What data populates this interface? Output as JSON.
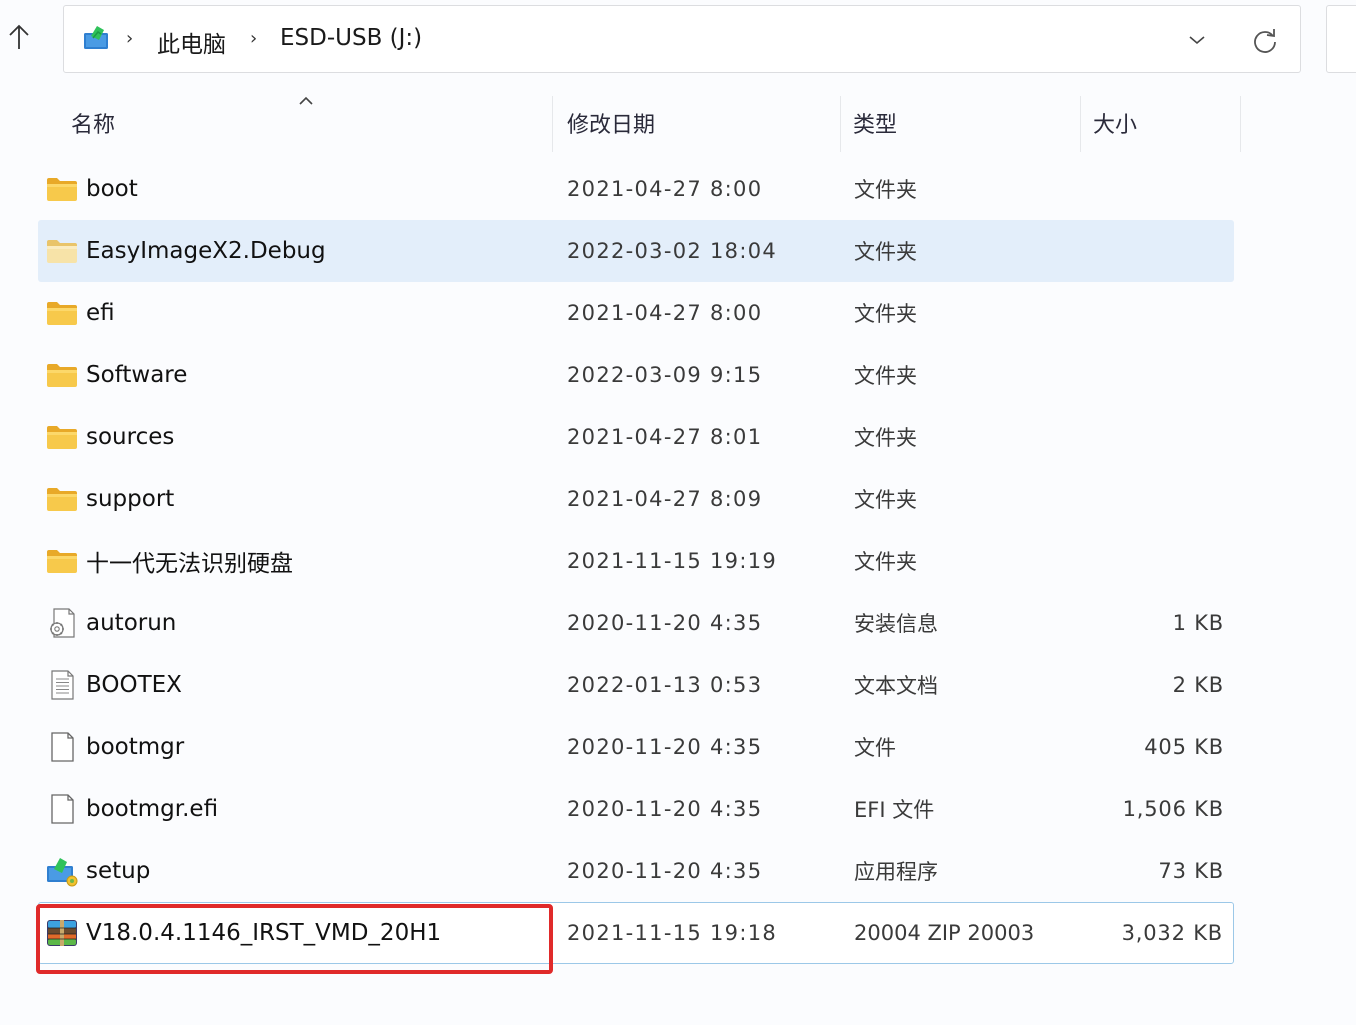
{
  "toolbar": {
    "up_icon": "arrow-up-icon",
    "breadcrumb": {
      "root_icon": "this-pc-icon",
      "separator": "›",
      "items": [
        "此电脑",
        "ESD-USB (J:)"
      ]
    },
    "dropdown_icon": "chevron-down-icon",
    "refresh_icon": "refresh-icon"
  },
  "columns": {
    "name": "名称",
    "date": "修改日期",
    "type": "类型",
    "size": "大小",
    "sort_indicator": "sort-ascending-icon"
  },
  "files": [
    {
      "name": "boot",
      "date": "2021-04-27 8:00",
      "type": "文件夹",
      "size": "",
      "icon": "folder-icon",
      "state": "normal"
    },
    {
      "name": "EasyImageX2.Debug",
      "date": "2022-03-02 18:04",
      "type": "文件夹",
      "size": "",
      "icon": "folder-icon",
      "state": "hover"
    },
    {
      "name": "efi",
      "date": "2021-04-27 8:00",
      "type": "文件夹",
      "size": "",
      "icon": "folder-icon",
      "state": "normal"
    },
    {
      "name": "Software",
      "date": "2022-03-09 9:15",
      "type": "文件夹",
      "size": "",
      "icon": "folder-icon",
      "state": "normal"
    },
    {
      "name": "sources",
      "date": "2021-04-27 8:01",
      "type": "文件夹",
      "size": "",
      "icon": "folder-icon",
      "state": "normal"
    },
    {
      "name": "support",
      "date": "2021-04-27 8:09",
      "type": "文件夹",
      "size": "",
      "icon": "folder-icon",
      "state": "normal"
    },
    {
      "name": "十一代无法识别硬盘",
      "date": "2021-11-15 19:19",
      "type": "文件夹",
      "size": "",
      "icon": "folder-icon",
      "state": "normal"
    },
    {
      "name": "autorun",
      "date": "2020-11-20 4:35",
      "type": "安装信息",
      "size": "1 KB",
      "icon": "setup-info-file-icon",
      "state": "normal"
    },
    {
      "name": "BOOTEX",
      "date": "2022-01-13 0:53",
      "type": "文本文档",
      "size": "2 KB",
      "icon": "text-document-icon",
      "state": "normal"
    },
    {
      "name": "bootmgr",
      "date": "2020-11-20 4:35",
      "type": "文件",
      "size": "405 KB",
      "icon": "blank-file-icon",
      "state": "normal"
    },
    {
      "name": "bootmgr.efi",
      "date": "2020-11-20 4:35",
      "type": "EFI 文件",
      "size": "1,506 KB",
      "icon": "blank-file-icon",
      "state": "normal"
    },
    {
      "name": "setup",
      "date": "2020-11-20 4:35",
      "type": "应用程序",
      "size": "73 KB",
      "icon": "installer-app-icon",
      "state": "normal"
    },
    {
      "name": "V18.0.4.1146_IRST_VMD_20H1",
      "date": "2021-11-15 19:18",
      "type": "20004 ZIP 20003",
      "size": "3,032 KB",
      "icon": "winrar-archive-icon",
      "state": "selected"
    }
  ],
  "annotation": {
    "highlighted_item": "V18.0.4.1146_IRST_VMD_20H1",
    "color": "#e02a2a"
  },
  "colors": {
    "hover_row": "#e3eefa",
    "selected_border": "#9cc8e8",
    "folder": "#f5c542"
  }
}
